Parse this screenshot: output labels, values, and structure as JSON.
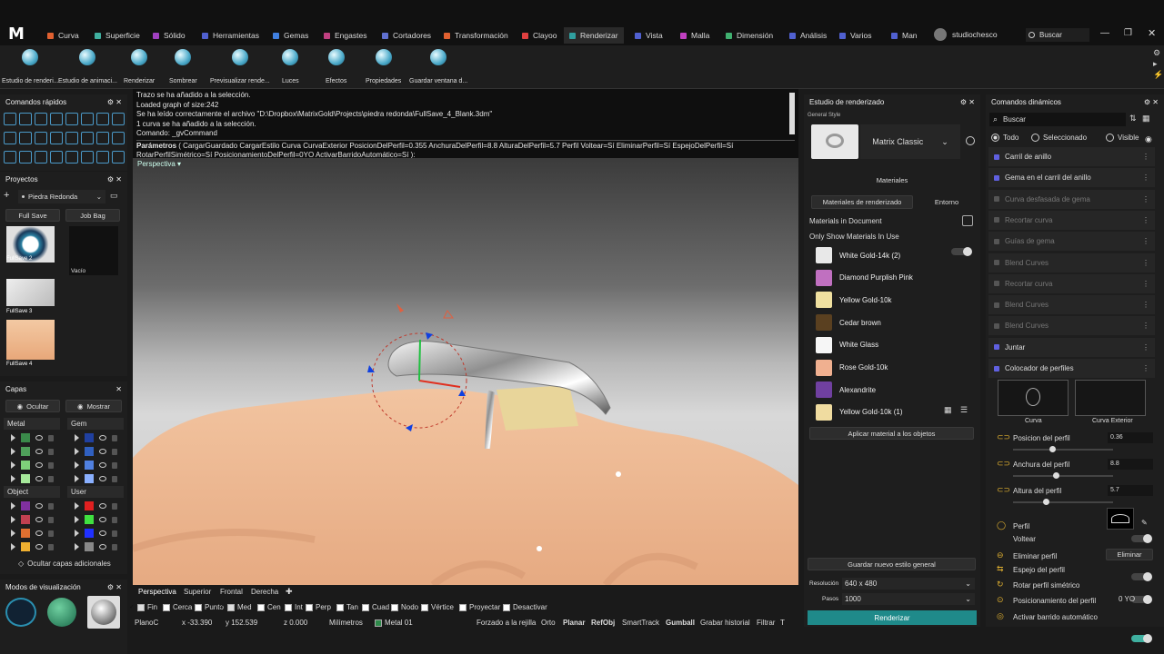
{
  "app": {
    "logo": "M"
  },
  "menu": {
    "tabs": [
      {
        "label": "Curva",
        "color": "#e06030"
      },
      {
        "label": "Superficie",
        "color": "#40b0a0"
      },
      {
        "label": "Sólido",
        "color": "#a040c0"
      },
      {
        "label": "Herramientas",
        "color": "#5060d0"
      },
      {
        "label": "Gemas",
        "color": "#4080e0"
      },
      {
        "label": "Engastes",
        "color": "#c04080"
      },
      {
        "label": "Cortadores",
        "color": "#6070d0"
      },
      {
        "label": "Transformación",
        "color": "#e06030"
      },
      {
        "label": "Clayoo",
        "color": "#e04040"
      },
      {
        "label": "Renderizar",
        "color": "#30a0a0"
      },
      {
        "label": "Vista",
        "color": "#5060d0"
      },
      {
        "label": "Malla",
        "color": "#c040c0"
      },
      {
        "label": "Dimensión",
        "color": "#40b070"
      },
      {
        "label": "Análisis",
        "color": "#5060d0"
      },
      {
        "label": "Varios",
        "color": "#5060d0"
      },
      {
        "label": "Man",
        "color": "#5060d0"
      }
    ],
    "user": "studiochesco",
    "search_placeholder": "Buscar"
  },
  "toolbar": {
    "items": [
      {
        "label": "Estudio de renderi...",
        "icon": "render-studio-icon"
      },
      {
        "label": "Estudio de animaci...",
        "icon": "animation-studio-icon"
      },
      {
        "label": "Renderizar",
        "icon": "render-icon"
      },
      {
        "label": "Sombrear",
        "icon": "shade-icon"
      },
      {
        "label": "Previsualizar rende...",
        "icon": "preview-render-icon"
      },
      {
        "label": "Luces",
        "icon": "lights-icon"
      },
      {
        "label": "Efectos",
        "icon": "effects-icon"
      },
      {
        "label": "Propiedades",
        "icon": "properties-icon"
      },
      {
        "label": "Guardar ventana d...",
        "icon": "save-window-icon"
      }
    ]
  },
  "quick": {
    "title": "Comandos rápidos"
  },
  "projects": {
    "title": "Proyectos",
    "project_name": "Piedra Redonda",
    "btn_fullsave": "Full Save",
    "btn_jobbag": "Job Bag",
    "thumbs": [
      "FullSave 2",
      "FullSave 3",
      "FullSave 4"
    ],
    "empty": "Vacío"
  },
  "layers": {
    "title": "Capas",
    "hide": "Ocultar",
    "show": "Mostrar",
    "groups": [
      {
        "name": "Metal",
        "colors": [
          "#3a8a4a",
          "#4fa05a",
          "#7fd07a",
          "#a6e89a"
        ]
      },
      {
        "name": "Gem",
        "colors": [
          "#2040a0",
          "#3060c0",
          "#5080e0",
          "#8ab0ff"
        ]
      },
      {
        "name": "Object",
        "colors": [
          "#8030a0",
          "#c04050",
          "#e07030",
          "#f0b030"
        ]
      },
      {
        "name": "User",
        "colors": [
          "#e02020",
          "#40e040",
          "#2030ff",
          "#888888"
        ]
      }
    ],
    "hide_extra": "Ocultar capas adicionales"
  },
  "viewmodes": {
    "title": "Modos de visualización"
  },
  "command": {
    "lines": [
      "Trazo se ha añadido a la selección.",
      "Loaded graph of size:242",
      "Se ha leído correctamente el archivo \"D:\\Dropbox\\MatrixGold\\Projects\\piedra redonda\\FullSave_4_Blank.3dm\"",
      "1 curva se ha añadido a la selección.",
      "Comando: _gvCommand"
    ],
    "params_label": "Parámetros",
    "params_line1": "( CargarGuardado  CargarEstilo  Curva  CurvaExterior  PosicionDelPerfil=0.355  AnchuraDelPerfil=8.8  AlturaDelPerfil=5.7  Perfil  Voltear=Sí  EliminarPerfil=Sí  EspejoDelPerfil=Sí",
    "params_line2": "RotarPerfilSimétrico=Sí  PosicionamientoDelPerfil=0YO  ActivarBarridoAutomático=Sí ):"
  },
  "viewport": {
    "label": "Perspectiva"
  },
  "viewtabs": [
    "Perspectiva",
    "Superior",
    "Frontal",
    "Derecha"
  ],
  "osnaps": [
    {
      "label": "Fin",
      "on": true
    },
    {
      "label": "Cerca",
      "on": false
    },
    {
      "label": "Punto",
      "on": false
    },
    {
      "label": "Med",
      "on": true
    },
    {
      "label": "Cen",
      "on": false
    },
    {
      "label": "Int",
      "on": false
    },
    {
      "label": "Perp",
      "on": false
    },
    {
      "label": "Tan",
      "on": false
    },
    {
      "label": "Cuad",
      "on": false
    },
    {
      "label": "Nodo",
      "on": false
    },
    {
      "label": "Vértice",
      "on": false
    },
    {
      "label": "Proyectar",
      "on": false
    },
    {
      "label": "Desactivar",
      "on": false
    }
  ],
  "statusbar": {
    "cplane": "PlanoC",
    "x": "x -33.390",
    "y": "y 152.539",
    "z": "z 0.000",
    "units": "Milímetros",
    "layer": "Metal 01",
    "toggles": [
      "Forzado a la rejilla",
      "Orto",
      "Planar",
      "RefObj",
      "SmartTrack",
      "Gumball",
      "Grabar historial",
      "Filtrar"
    ],
    "extra": "T"
  },
  "render_studio": {
    "title": "Estudio de renderizado",
    "general_style": "General Style",
    "style_name": "Matrix Classic",
    "materials_heading": "Materiales",
    "tab_render_materials": "Materiales de renderizado",
    "tab_environment": "Entorno",
    "materials_in_doc": "Materials in Document",
    "only_show": "Only Show Materials In Use",
    "materials": [
      {
        "name": "White Gold-14k (2)",
        "color": "#e8e8e8"
      },
      {
        "name": "Diamond Purplish Pink",
        "color": "#c070c0"
      },
      {
        "name": "Yellow Gold-10k",
        "color": "#f0e0a0"
      },
      {
        "name": "Cedar brown",
        "color": "#5a4020"
      },
      {
        "name": "White Glass",
        "color": "#f6f6f6"
      },
      {
        "name": "Rose Gold-10k",
        "color": "#f0b090"
      },
      {
        "name": "Alexandrite",
        "color": "#7040a0"
      },
      {
        "name": "Yellow Gold-10k (1)",
        "color": "#f0dca0"
      }
    ],
    "apply_btn": "Aplicar material a los objetos",
    "save_style_btn": "Guardar nuevo estilo general",
    "resolution_label": "Resolución",
    "resolution": "640 x 480",
    "passes_label": "Pasos",
    "passes": "1000",
    "render_btn": "Renderizar"
  },
  "dynamic": {
    "title": "Comandos dinámicos",
    "search_placeholder": "Buscar",
    "filters": [
      "Todo",
      "Seleccionado",
      "Visible"
    ],
    "items": [
      {
        "label": "Carril de anillo",
        "color": "#6060e0",
        "enabled": true
      },
      {
        "label": "Gema en el carril del anillo",
        "color": "#6060e0",
        "enabled": true
      },
      {
        "label": "Curva desfasada de gema",
        "color": "#555",
        "enabled": false
      },
      {
        "label": "Recortar curva",
        "color": "#555",
        "enabled": false
      },
      {
        "label": "Guías de gema",
        "color": "#555",
        "enabled": false
      },
      {
        "label": "Blend Curves",
        "color": "#555",
        "enabled": false
      },
      {
        "label": "Recortar curva",
        "color": "#555",
        "enabled": false
      },
      {
        "label": "Blend Curves",
        "color": "#555",
        "enabled": false
      },
      {
        "label": "Blend Curves",
        "color": "#555",
        "enabled": false
      },
      {
        "label": "Juntar",
        "color": "#6060e0",
        "enabled": true
      },
      {
        "label": "Colocador de perfiles",
        "color": "#6060e0",
        "enabled": true
      }
    ],
    "curve_label": "Curva",
    "outer_curve_label": "Curva Exterior",
    "params": [
      {
        "label": "Posicion del perfil",
        "value": "0.36",
        "level": 0.36
      },
      {
        "label": "Anchura del perfil",
        "value": "8.8",
        "level": 0.4
      },
      {
        "label": "Altura del perfil",
        "value": "5.7",
        "level": 0.3
      }
    ],
    "profile_label": "Perfil",
    "flip_label": "Voltear",
    "delete_profile_label": "Eliminar perfil",
    "delete_btn": "Eliminar",
    "mirror_label": "Espejo del perfil",
    "rotate_label": "Rotar perfil simétrico",
    "positioning_label": "Posicionamiento del perfil",
    "positioning_value": "0 YO",
    "autosweep_label": "Activar barrido automático"
  }
}
